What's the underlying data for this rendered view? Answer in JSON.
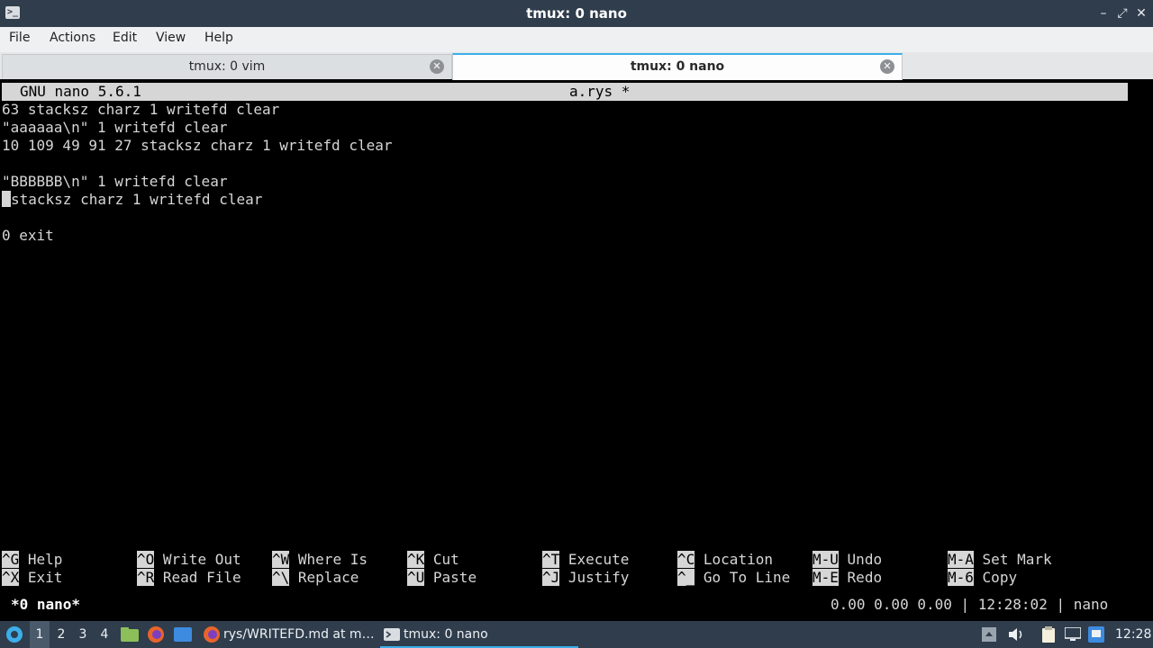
{
  "window": {
    "title": "tmux: 0 nano"
  },
  "menu": {
    "items": [
      "File",
      "Actions",
      "Edit",
      "View",
      "Help"
    ]
  },
  "tabs": [
    {
      "label": "tmux: 0 vim"
    },
    {
      "label": "tmux: 0 nano"
    }
  ],
  "nano": {
    "version": "GNU nano 5.6.1",
    "filename": "a.rys *",
    "lines": [
      "63 stacksz charz 1 writefd clear",
      "\"aaaaaa\\n\" 1 writefd clear",
      "10 109 49 91 27 stacksz charz 1 writefd clear",
      "",
      "\"BBBBBB\\n\" 1 writefd clear",
      "stacksz charz 1 writefd clear",
      "",
      "0 exit"
    ],
    "shortcuts_row1": [
      {
        "key": "^G",
        "label": "Help"
      },
      {
        "key": "^O",
        "label": "Write Out"
      },
      {
        "key": "^W",
        "label": "Where Is"
      },
      {
        "key": "^K",
        "label": "Cut"
      },
      {
        "key": "^T",
        "label": "Execute"
      },
      {
        "key": "^C",
        "label": "Location"
      },
      {
        "key": "M-U",
        "label": "Undo"
      },
      {
        "key": "M-A",
        "label": "Set Mark"
      }
    ],
    "shortcuts_row2": [
      {
        "key": "^X",
        "label": "Exit"
      },
      {
        "key": "^R",
        "label": "Read File"
      },
      {
        "key": "^\\",
        "label": "Replace"
      },
      {
        "key": "^U",
        "label": "Paste"
      },
      {
        "key": "^J",
        "label": "Justify"
      },
      {
        "key": "^_",
        "label": "Go To Line"
      },
      {
        "key": "M-E",
        "label": "Redo"
      },
      {
        "key": "M-6",
        "label": "Copy"
      }
    ]
  },
  "tmux_status": {
    "session": "*0 nano*",
    "right": "0.00 0.00 0.00 | 12:28:02 | nano"
  },
  "taskbar": {
    "workspaces": [
      "1",
      "2",
      "3",
      "4"
    ],
    "tasks": [
      {
        "label": "rys/WRITEFD.md at m…",
        "icon": "firefox-icon"
      },
      {
        "label": "tmux: 0 nano",
        "icon": "terminal-icon"
      }
    ],
    "clock": "12:28"
  }
}
